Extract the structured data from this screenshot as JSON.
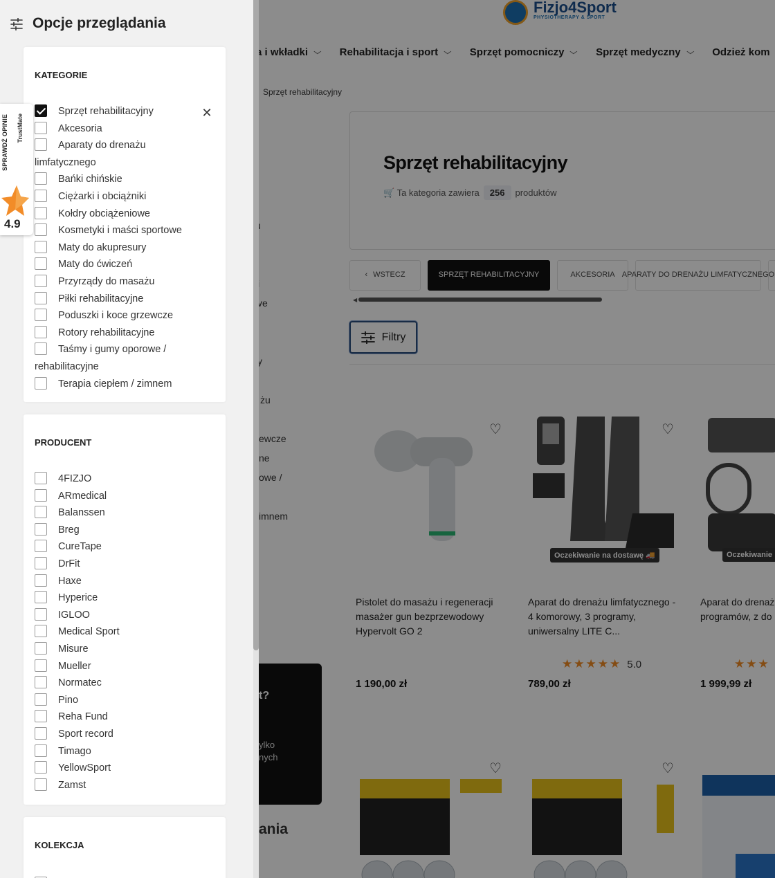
{
  "site": {
    "logo_brand": "Fizjo4Sport",
    "logo_tagline": "PHYSIOTHERAPY & SPORT"
  },
  "nav": {
    "items": [
      {
        "label": "a i wkładki"
      },
      {
        "label": "Rehabilitacja i sport"
      },
      {
        "label": "Sprzęt pomocniczy"
      },
      {
        "label": "Sprzęt medyczny"
      },
      {
        "label": "Odzież kom"
      }
    ]
  },
  "breadcrumb": {
    "current": "Sprzęt rehabilitacyjny"
  },
  "category": {
    "title": "Sprzęt rehabilitacyjny",
    "count_prefix": "🛒 Ta kategoria zawiera",
    "count": "256",
    "count_suffix": "produktów"
  },
  "chips": {
    "back": "WSTECZ",
    "items": [
      "SPRZĘT REHABILITACYJNY",
      "AKCESORIA",
      "APARATY DO DRENAŻU LIMFATYCZNEGO"
    ]
  },
  "filters_button": "Filtry",
  "background_left": {
    "fragments": [
      "u",
      "i",
      "ve",
      "y",
      "żu",
      "ewcze",
      "ne",
      "owe /",
      "imnem",
      "t?",
      "ylko",
      "nych",
      "ania"
    ]
  },
  "products": [
    {
      "name": "Pistolet do masażu i regeneracji masażer gun bezprzewodowy Hypervolt GO 2",
      "price": "1 190,00 zł",
      "rating": "",
      "badge": ""
    },
    {
      "name": "Aparat do drenażu limfatycznego - 4 komorowy, 3 programy, uniwersalny LITE C...",
      "price": "789,00 zł",
      "rating": "5.0",
      "badge": "Oczekiwanie na dostawę 🚚"
    },
    {
      "name": "Aparat do drenażu limfatycznego - programów, z do",
      "price": "1 999,99 zł",
      "rating": "",
      "badge": "Oczekiwanie"
    }
  ],
  "trustmate": {
    "label": "SPRAWDŹ OPINIE",
    "brand": "TrustMate",
    "score": "4.9"
  },
  "panel": {
    "title": "Opcje przeglądania",
    "sections": {
      "kategorie": {
        "title": "KATEGORIE",
        "options": [
          {
            "label": "Sprzęt rehabilitacyjny",
            "checked": true
          },
          {
            "label": "Akcesoria",
            "checked": false
          },
          {
            "label": "Aparaty do drenażu limfatycznego",
            "checked": false
          },
          {
            "label": "Bańki chińskie",
            "checked": false
          },
          {
            "label": "Ciężarki i obciążniki",
            "checked": false
          },
          {
            "label": "Kołdry obciążeniowe",
            "checked": false
          },
          {
            "label": "Kosmetyki i maści sportowe",
            "checked": false
          },
          {
            "label": "Maty do akupresury",
            "checked": false
          },
          {
            "label": "Maty do ćwiczeń",
            "checked": false
          },
          {
            "label": "Przyrządy do masażu",
            "checked": false
          },
          {
            "label": "Piłki rehabilitacyjne",
            "checked": false
          },
          {
            "label": "Poduszki i koce grzewcze",
            "checked": false
          },
          {
            "label": "Rotory rehabilitacyjne",
            "checked": false
          },
          {
            "label": "Taśmy i gumy oporowe / rehabilitacyjne",
            "checked": false
          },
          {
            "label": "Terapia ciepłem / zimnem",
            "checked": false
          }
        ]
      },
      "producent": {
        "title": "PRODUCENT",
        "options": [
          {
            "label": "4FIZJO",
            "checked": false
          },
          {
            "label": "ARmedical",
            "checked": false
          },
          {
            "label": "Balanssen",
            "checked": false
          },
          {
            "label": "Breg",
            "checked": false
          },
          {
            "label": "CureTape",
            "checked": false
          },
          {
            "label": "DrFit",
            "checked": false
          },
          {
            "label": "Haxe",
            "checked": false
          },
          {
            "label": "Hyperice",
            "checked": false
          },
          {
            "label": "IGLOO",
            "checked": false
          },
          {
            "label": "Medical Sport",
            "checked": false
          },
          {
            "label": "Misure",
            "checked": false
          },
          {
            "label": "Mueller",
            "checked": false
          },
          {
            "label": "Normatec",
            "checked": false
          },
          {
            "label": "Pino",
            "checked": false
          },
          {
            "label": "Reha Fund",
            "checked": false
          },
          {
            "label": "Sport record",
            "checked": false
          },
          {
            "label": "Timago",
            "checked": false
          },
          {
            "label": "YellowSport",
            "checked": false
          },
          {
            "label": "Zamst",
            "checked": false
          }
        ]
      },
      "kolekcja": {
        "title": "KOLEKCJA"
      }
    }
  }
}
